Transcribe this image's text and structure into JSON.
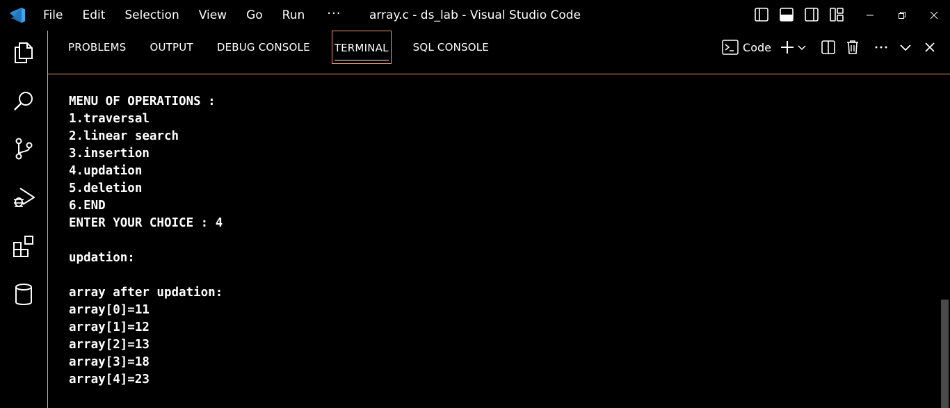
{
  "window": {
    "title": "array.c - ds_lab - Visual Studio Code"
  },
  "menu": {
    "items": [
      "File",
      "Edit",
      "Selection",
      "View",
      "Go",
      "Run"
    ],
    "more": "···"
  },
  "activity_bar": {
    "items": [
      "explorer-icon",
      "search-icon",
      "source-control-icon",
      "run-debug-icon",
      "extensions-icon",
      "database-icon"
    ]
  },
  "panel": {
    "tabs": [
      {
        "label": "PROBLEMS"
      },
      {
        "label": "OUTPUT"
      },
      {
        "label": "DEBUG CONSOLE"
      },
      {
        "label": "TERMINAL"
      },
      {
        "label": "SQL CONSOLE"
      }
    ],
    "active_tab": "TERMINAL",
    "terminal_type": "Code"
  },
  "terminal": {
    "lines": [
      "MENU OF OPERATIONS :",
      "1.traversal",
      "2.linear search",
      "3.insertion",
      "4.updation",
      "5.deletion",
      "6.END",
      "ENTER YOUR CHOICE : 4",
      "",
      "updation:",
      "",
      "array after updation:",
      "array[0]=11",
      "array[1]=12",
      "array[2]=13",
      "array[3]=18",
      "array[4]=23"
    ]
  },
  "colors": {
    "background": "#000000",
    "focus_border": "#f0a070",
    "logo_blue": "#3ea6f0"
  }
}
